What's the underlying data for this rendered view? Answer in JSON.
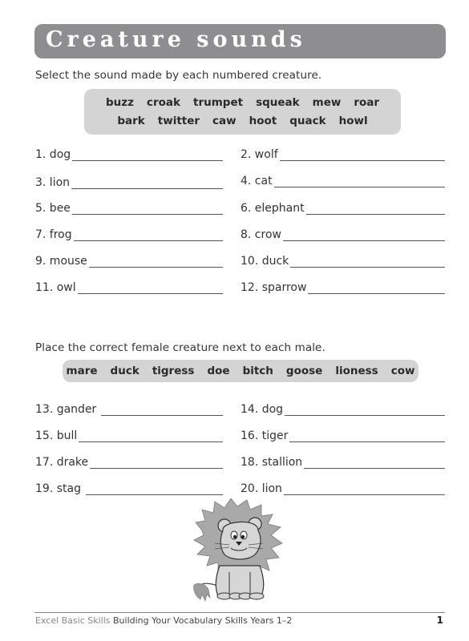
{
  "title": "Creature sounds",
  "section1": {
    "instruction": "Select the sound made by each numbered creature.",
    "word_bank_rows": [
      [
        "buzz",
        "croak",
        "trumpet",
        "squeak",
        "mew",
        "roar"
      ],
      [
        "bark",
        "twitter",
        "caw",
        "hoot",
        "quack",
        "howl"
      ]
    ],
    "items": [
      {
        "label": "1. dog",
        "answer": ""
      },
      {
        "label": "2. wolf",
        "answer": ""
      },
      {
        "label": "3. lion",
        "answer": ""
      },
      {
        "label": "4. cat",
        "answer": ""
      },
      {
        "label": "5. bee",
        "answer": ""
      },
      {
        "label": "6. elephant",
        "answer": ""
      },
      {
        "label": "7. frog",
        "answer": ""
      },
      {
        "label": "8. crow",
        "answer": ""
      },
      {
        "label": "9. mouse",
        "answer": ""
      },
      {
        "label": "10. duck",
        "answer": ""
      },
      {
        "label": "11. owl",
        "answer": ""
      },
      {
        "label": "12. sparrow",
        "answer": ""
      }
    ]
  },
  "section2": {
    "instruction": "Place the correct female creature next to each male.",
    "word_bank": [
      "mare",
      "duck",
      "tigress",
      "doe",
      "bitch",
      "goose",
      "lioness",
      "cow"
    ],
    "items": [
      {
        "label": "13. gander",
        "answer": ""
      },
      {
        "label": "14. dog",
        "answer": ""
      },
      {
        "label": "15. bull",
        "answer": ""
      },
      {
        "label": "16. tiger",
        "answer": ""
      },
      {
        "label": "17. drake",
        "answer": ""
      },
      {
        "label": "18. stallion",
        "answer": ""
      },
      {
        "label": "19. stag",
        "answer": ""
      },
      {
        "label": "20. lion",
        "answer": ""
      }
    ]
  },
  "illustration": "lion-cartoon",
  "footer": {
    "series": "Excel Basic Skills",
    "book": "Building Your Vocabulary Skills Years 1–2",
    "page_number": "1"
  },
  "colors": {
    "title_bar": "#8e8e90",
    "word_box": "#d4d4d5"
  }
}
